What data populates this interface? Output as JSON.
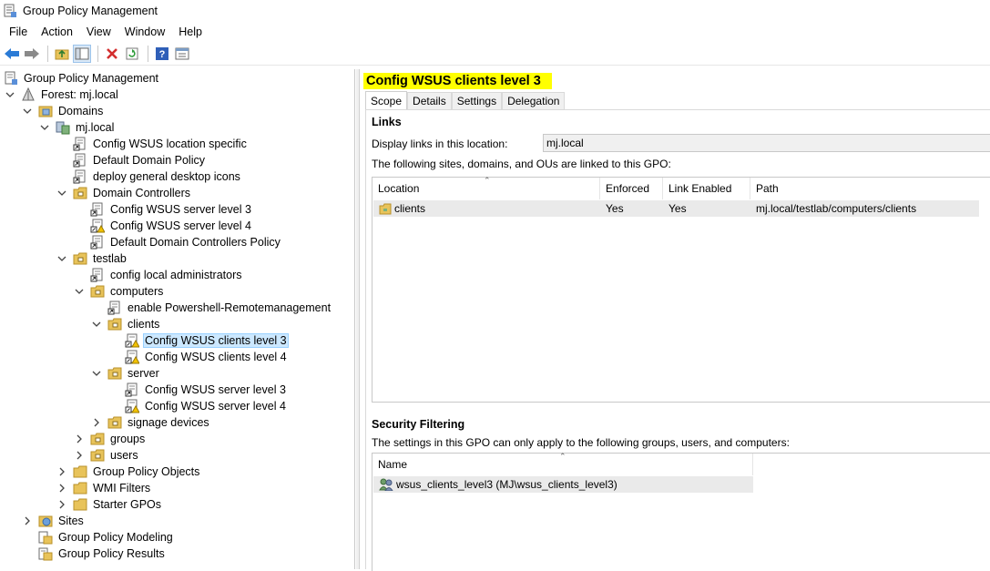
{
  "window": {
    "title": "Group Policy Management"
  },
  "menu": [
    "File",
    "Action",
    "View",
    "Window",
    "Help"
  ],
  "toolbar": [
    "back-icon",
    "forward-icon",
    "up-folder-icon",
    "show-hide-tree-icon",
    "delete-icon",
    "refresh-icon",
    "help-icon",
    "properties-icon"
  ],
  "tree": [
    {
      "label": "Group Policy Management",
      "icon": "gpm-icon"
    },
    {
      "label": "Forest: mj.local",
      "icon": "forest-icon"
    },
    {
      "label": "Domains",
      "icon": "domains-icon"
    },
    {
      "label": "mj.local",
      "icon": "domain-icon"
    },
    {
      "label": "Config WSUS location specific",
      "icon": "gpo-link-icon"
    },
    {
      "label": "Default Domain Policy",
      "icon": "gpo-link-icon"
    },
    {
      "label": "deploy general desktop icons",
      "icon": "gpo-link-icon"
    },
    {
      "label": "Domain Controllers",
      "icon": "ou-icon"
    },
    {
      "label": "Config WSUS server level 3",
      "icon": "gpo-link-icon"
    },
    {
      "label": "Config WSUS server level 4",
      "icon": "gpo-link-warning-icon"
    },
    {
      "label": "Default Domain Controllers Policy",
      "icon": "gpo-link-icon"
    },
    {
      "label": "testlab",
      "icon": "ou-icon"
    },
    {
      "label": "config local administrators",
      "icon": "gpo-link-icon"
    },
    {
      "label": "computers",
      "icon": "ou-icon"
    },
    {
      "label": "enable Powershell-Remotemanagement",
      "icon": "gpo-link-icon"
    },
    {
      "label": "clients",
      "icon": "ou-icon"
    },
    {
      "label": "Config WSUS clients level 3",
      "icon": "gpo-link-warning-icon"
    },
    {
      "label": "Config WSUS clients level 4",
      "icon": "gpo-link-warning-icon"
    },
    {
      "label": "server",
      "icon": "ou-icon"
    },
    {
      "label": "Config WSUS server level 3",
      "icon": "gpo-link-icon"
    },
    {
      "label": "Config WSUS server level 4",
      "icon": "gpo-link-warning-icon"
    },
    {
      "label": "signage devices",
      "icon": "ou-icon"
    },
    {
      "label": "groups",
      "icon": "ou-icon"
    },
    {
      "label": "users",
      "icon": "ou-icon"
    },
    {
      "label": "Group Policy Objects",
      "icon": "folder-icon"
    },
    {
      "label": "WMI Filters",
      "icon": "folder-icon"
    },
    {
      "label": "Starter GPOs",
      "icon": "folder-icon"
    },
    {
      "label": "Sites",
      "icon": "sites-icon"
    },
    {
      "label": "Group Policy Modeling",
      "icon": "modeling-icon"
    },
    {
      "label": "Group Policy Results",
      "icon": "results-icon"
    }
  ],
  "selected_node": "Config WSUS clients level 3",
  "detail": {
    "title": "Config WSUS clients level 3",
    "tabs": [
      "Scope",
      "Details",
      "Settings",
      "Delegation"
    ],
    "active_tab": "Scope",
    "links_heading": "Links",
    "display_links_label": "Display links in this location:",
    "display_links_value": "mj.local",
    "linked_text": "The following sites, domains, and OUs are linked to this GPO:",
    "links_columns": [
      "Location",
      "Enforced",
      "Link Enabled",
      "Path"
    ],
    "links_rows": [
      {
        "location": "clients",
        "enforced": "Yes",
        "link_enabled": "Yes",
        "path": "mj.local/testlab/computers/clients"
      }
    ],
    "security_heading": "Security Filtering",
    "security_text": "The settings in this GPO can only apply to the following groups, users, and computers:",
    "security_columns": [
      "Name"
    ],
    "security_rows": [
      "wsus_clients_level3 (MJ\\wsus_clients_level3)"
    ]
  },
  "highlight_color": "#ffff00",
  "selection_color": "#cce8ff"
}
